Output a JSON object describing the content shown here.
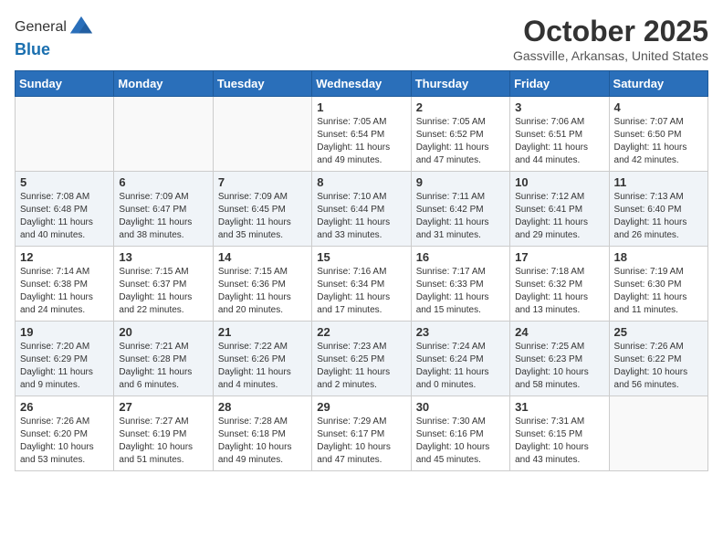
{
  "header": {
    "logo": {
      "line1": "General",
      "line2": "Blue"
    },
    "title": "October 2025",
    "location": "Gassville, Arkansas, United States"
  },
  "days_of_week": [
    "Sunday",
    "Monday",
    "Tuesday",
    "Wednesday",
    "Thursday",
    "Friday",
    "Saturday"
  ],
  "weeks": [
    {
      "days": [
        {
          "num": "",
          "info": ""
        },
        {
          "num": "",
          "info": ""
        },
        {
          "num": "",
          "info": ""
        },
        {
          "num": "1",
          "info": "Sunrise: 7:05 AM\nSunset: 6:54 PM\nDaylight: 11 hours\nand 49 minutes."
        },
        {
          "num": "2",
          "info": "Sunrise: 7:05 AM\nSunset: 6:52 PM\nDaylight: 11 hours\nand 47 minutes."
        },
        {
          "num": "3",
          "info": "Sunrise: 7:06 AM\nSunset: 6:51 PM\nDaylight: 11 hours\nand 44 minutes."
        },
        {
          "num": "4",
          "info": "Sunrise: 7:07 AM\nSunset: 6:50 PM\nDaylight: 11 hours\nand 42 minutes."
        }
      ]
    },
    {
      "days": [
        {
          "num": "5",
          "info": "Sunrise: 7:08 AM\nSunset: 6:48 PM\nDaylight: 11 hours\nand 40 minutes."
        },
        {
          "num": "6",
          "info": "Sunrise: 7:09 AM\nSunset: 6:47 PM\nDaylight: 11 hours\nand 38 minutes."
        },
        {
          "num": "7",
          "info": "Sunrise: 7:09 AM\nSunset: 6:45 PM\nDaylight: 11 hours\nand 35 minutes."
        },
        {
          "num": "8",
          "info": "Sunrise: 7:10 AM\nSunset: 6:44 PM\nDaylight: 11 hours\nand 33 minutes."
        },
        {
          "num": "9",
          "info": "Sunrise: 7:11 AM\nSunset: 6:42 PM\nDaylight: 11 hours\nand 31 minutes."
        },
        {
          "num": "10",
          "info": "Sunrise: 7:12 AM\nSunset: 6:41 PM\nDaylight: 11 hours\nand 29 minutes."
        },
        {
          "num": "11",
          "info": "Sunrise: 7:13 AM\nSunset: 6:40 PM\nDaylight: 11 hours\nand 26 minutes."
        }
      ]
    },
    {
      "days": [
        {
          "num": "12",
          "info": "Sunrise: 7:14 AM\nSunset: 6:38 PM\nDaylight: 11 hours\nand 24 minutes."
        },
        {
          "num": "13",
          "info": "Sunrise: 7:15 AM\nSunset: 6:37 PM\nDaylight: 11 hours\nand 22 minutes."
        },
        {
          "num": "14",
          "info": "Sunrise: 7:15 AM\nSunset: 6:36 PM\nDaylight: 11 hours\nand 20 minutes."
        },
        {
          "num": "15",
          "info": "Sunrise: 7:16 AM\nSunset: 6:34 PM\nDaylight: 11 hours\nand 17 minutes."
        },
        {
          "num": "16",
          "info": "Sunrise: 7:17 AM\nSunset: 6:33 PM\nDaylight: 11 hours\nand 15 minutes."
        },
        {
          "num": "17",
          "info": "Sunrise: 7:18 AM\nSunset: 6:32 PM\nDaylight: 11 hours\nand 13 minutes."
        },
        {
          "num": "18",
          "info": "Sunrise: 7:19 AM\nSunset: 6:30 PM\nDaylight: 11 hours\nand 11 minutes."
        }
      ]
    },
    {
      "days": [
        {
          "num": "19",
          "info": "Sunrise: 7:20 AM\nSunset: 6:29 PM\nDaylight: 11 hours\nand 9 minutes."
        },
        {
          "num": "20",
          "info": "Sunrise: 7:21 AM\nSunset: 6:28 PM\nDaylight: 11 hours\nand 6 minutes."
        },
        {
          "num": "21",
          "info": "Sunrise: 7:22 AM\nSunset: 6:26 PM\nDaylight: 11 hours\nand 4 minutes."
        },
        {
          "num": "22",
          "info": "Sunrise: 7:23 AM\nSunset: 6:25 PM\nDaylight: 11 hours\nand 2 minutes."
        },
        {
          "num": "23",
          "info": "Sunrise: 7:24 AM\nSunset: 6:24 PM\nDaylight: 11 hours\nand 0 minutes."
        },
        {
          "num": "24",
          "info": "Sunrise: 7:25 AM\nSunset: 6:23 PM\nDaylight: 10 hours\nand 58 minutes."
        },
        {
          "num": "25",
          "info": "Sunrise: 7:26 AM\nSunset: 6:22 PM\nDaylight: 10 hours\nand 56 minutes."
        }
      ]
    },
    {
      "days": [
        {
          "num": "26",
          "info": "Sunrise: 7:26 AM\nSunset: 6:20 PM\nDaylight: 10 hours\nand 53 minutes."
        },
        {
          "num": "27",
          "info": "Sunrise: 7:27 AM\nSunset: 6:19 PM\nDaylight: 10 hours\nand 51 minutes."
        },
        {
          "num": "28",
          "info": "Sunrise: 7:28 AM\nSunset: 6:18 PM\nDaylight: 10 hours\nand 49 minutes."
        },
        {
          "num": "29",
          "info": "Sunrise: 7:29 AM\nSunset: 6:17 PM\nDaylight: 10 hours\nand 47 minutes."
        },
        {
          "num": "30",
          "info": "Sunrise: 7:30 AM\nSunset: 6:16 PM\nDaylight: 10 hours\nand 45 minutes."
        },
        {
          "num": "31",
          "info": "Sunrise: 7:31 AM\nSunset: 6:15 PM\nDaylight: 10 hours\nand 43 minutes."
        },
        {
          "num": "",
          "info": ""
        }
      ]
    }
  ]
}
